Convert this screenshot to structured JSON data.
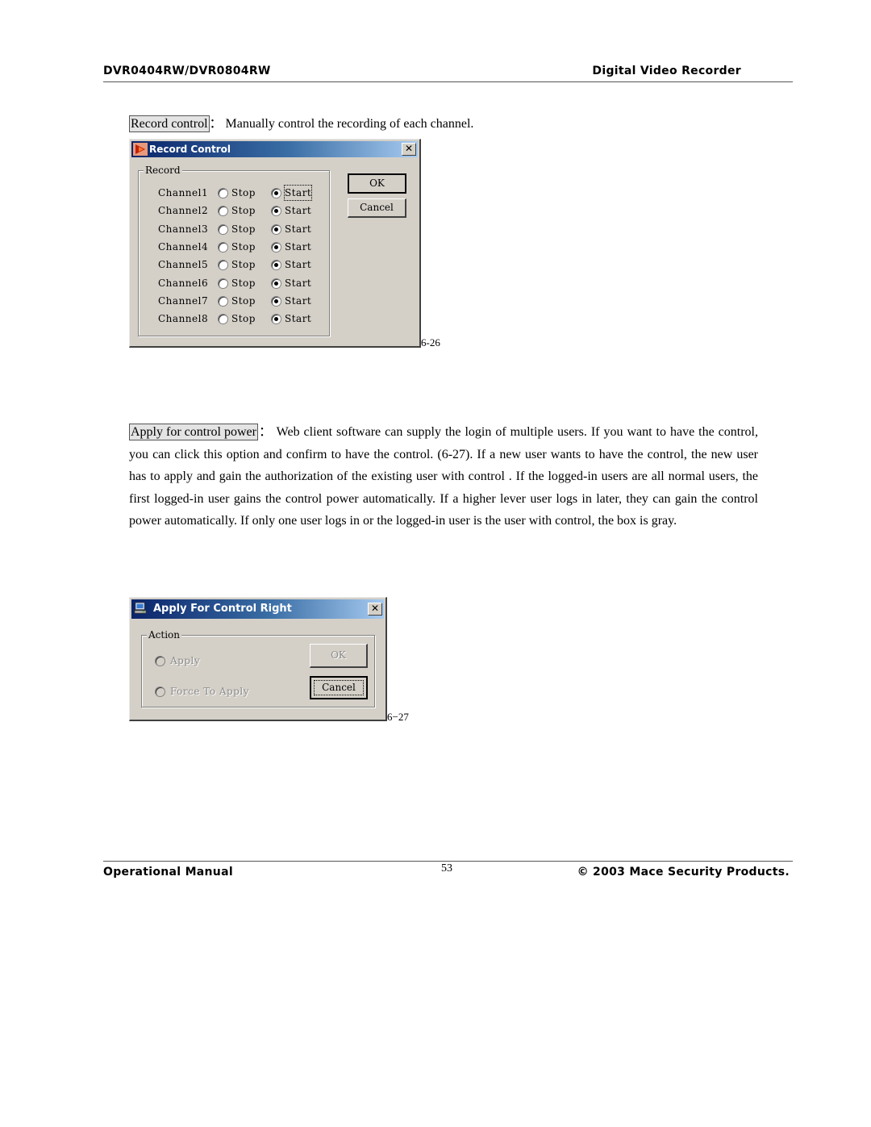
{
  "header": {
    "model": "DVR0404RW/DVR0804RW",
    "product": "Digital Video Recorder"
  },
  "section1": {
    "term": "Record control",
    "separator": "：",
    "description": "Manually control the recording of each channel."
  },
  "record_dialog": {
    "title": "Record Control",
    "group_label": "Record",
    "ok_label": "OK",
    "cancel_label": "Cancel",
    "close_symbol": "✕",
    "stop_label": "Stop",
    "start_label": "Start",
    "channels": [
      {
        "name": "Channel1",
        "state": "Start"
      },
      {
        "name": "Channel2",
        "state": "Start"
      },
      {
        "name": "Channel3",
        "state": "Start"
      },
      {
        "name": "Channel4",
        "state": "Start"
      },
      {
        "name": "Channel5",
        "state": "Start"
      },
      {
        "name": "Channel6",
        "state": "Start"
      },
      {
        "name": "Channel7",
        "state": "Start"
      },
      {
        "name": "Channel8",
        "state": "Start"
      }
    ],
    "caption": "6-26"
  },
  "section2": {
    "term": "Apply for control power",
    "separator": "：",
    "description": "Web client software can supply the login of multiple users. If you want to have the control, you can click this option and confirm to have the control. (6-27). If a new user wants to have the control, the new user has to apply and gain the authorization of the existing user with control . If the logged-in users are all normal users, the first logged-in user gains the control power automatically. If a higher lever user logs in later, they can gain the control power automatically. If only one user logs in or the logged-in user is the user with control, the box is gray."
  },
  "apply_dialog": {
    "title": "Apply For Control Right",
    "group_label": "Action",
    "option_apply": "Apply",
    "option_force": "Force To Apply",
    "ok_label": "OK",
    "cancel_label": "Cancel",
    "close_symbol": "✕",
    "caption": "6−27"
  },
  "footer": {
    "left": "Operational Manual",
    "page_number": "53",
    "right": "© 2003 Mace Security Products."
  }
}
